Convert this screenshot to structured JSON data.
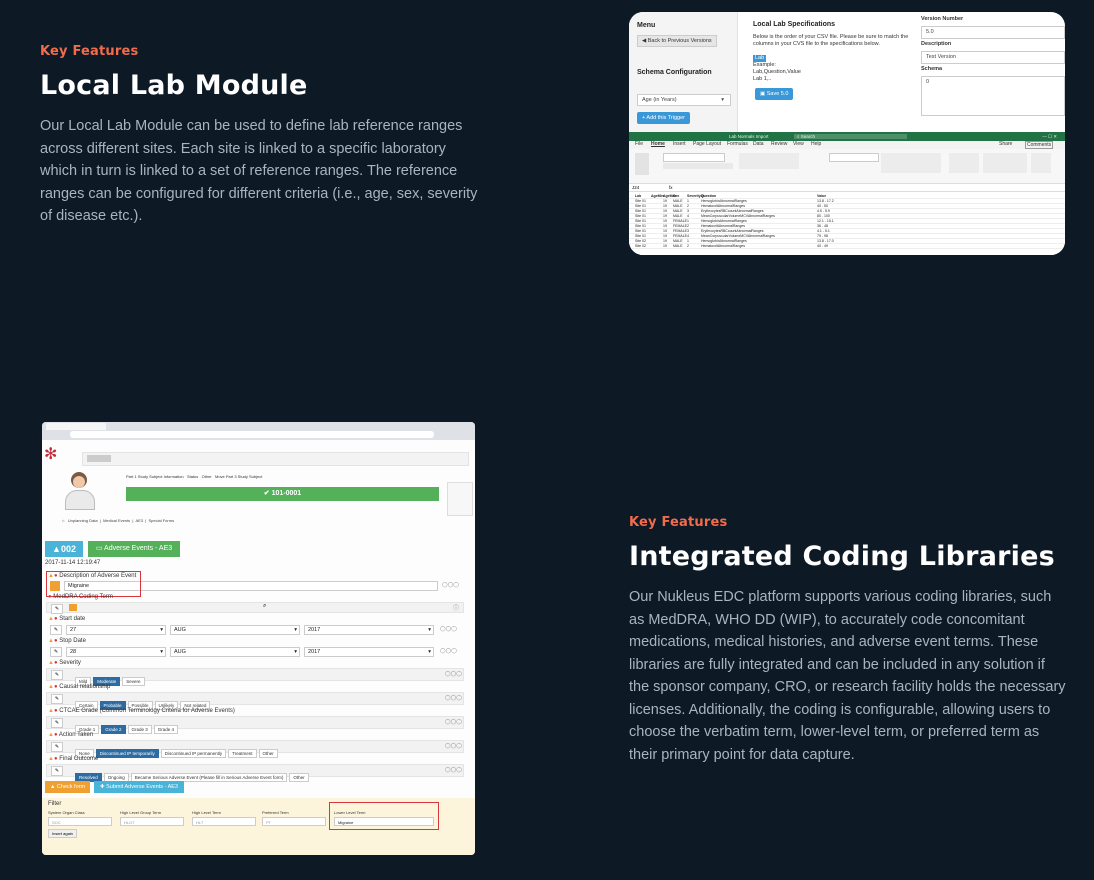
{
  "section1": {
    "eyebrow": "Key Features",
    "title": "Local Lab Module",
    "body": "Our Local Lab Module can be used to define lab reference ranges across different sites. Each site is linked to a specific laboratory which in turn is linked to a set of reference ranges. The reference ranges can be configured for different criteria (i.e., age, sex, severity of disease etc.)."
  },
  "section2": {
    "eyebrow": "Key Features",
    "title": "Integrated Coding Libraries",
    "body": "Our Nukleus EDC platform supports various coding libraries, such as MedDRA, WHO DD (WIP), to accurately code concomitant medications, medical histories, and adverse event terms. These libraries are fully integrated and can be included in any solution if the sponsor company, CRO, or research facility holds the necessary licenses. Additionally, the coding is configurable, allowing users to choose the verbatim term, lower-level term, or preferred term as their primary point for data capture."
  },
  "lab_shot": {
    "menu_title": "Menu",
    "back_button": "Back to Previous Versions",
    "schema_title": "Schema Configuration",
    "age_select": "Age (in Years)",
    "add_trigger": "+ Add this Trigger",
    "spec_title": "Local Lab Specifications",
    "spec_desc": "Below is the order of your CSV file. Please be sure to match the columns in your CVS file to the specifications below.",
    "lab_badge": "Lab",
    "example_label": "Example:",
    "example_cols": "Lab,Question,Value",
    "example_row": "Lab 1,..",
    "save_button": "Save 5.0",
    "version_label": "Version Number",
    "version_value": "5.0",
    "description_label": "Description",
    "description_value": "Test Version",
    "schema_label": "Schema",
    "schema_value": "0",
    "excel_title": "Lab Normals Import",
    "excel_search": "Search",
    "excel_tabs": [
      "File",
      "Home",
      "Insert",
      "Page Layout",
      "Formulas",
      "Data",
      "Review",
      "View",
      "Help"
    ],
    "excel_share": "Share",
    "excel_comments": "Comments",
    "excel_cell_ref": "J24",
    "excel_header": [
      "Lab",
      "AgeMin",
      "AgeMax",
      "Sex",
      "SeverityID",
      "Question",
      "Value"
    ],
    "excel_rows": [
      [
        "Site 01",
        "",
        "19",
        "MALE",
        "1",
        "HemoglobinAbnormalRanges",
        "13.8 - 17.2"
      ],
      [
        "Site 01",
        "",
        "19",
        "MALE",
        "2",
        "HematocritAbnormalRanges",
        "40 - 50"
      ],
      [
        "Site 01",
        "",
        "19",
        "MALE",
        "3",
        "ErythrocytesRBCcountAbnormalRanges",
        "4.5 - 5.9"
      ],
      [
        "Site 01",
        "",
        "19",
        "MALE",
        "4",
        "MeanCorpuscularVolumeMCVAbnormalRanges",
        "80 - 100"
      ],
      [
        "Site 01",
        "",
        "19",
        "FEMALE",
        "1",
        "HemoglobinAbnormalRanges",
        "12.1 - 15.1"
      ],
      [
        "Site 01",
        "",
        "19",
        "FEMALE",
        "2",
        "HematocritAbnormalRanges",
        "36 - 48"
      ],
      [
        "Site 01",
        "",
        "19",
        "FEMALE",
        "3",
        "ErythrocytesRBCcountAbnormalRanges",
        "4.1 - 5.1"
      ],
      [
        "Site 01",
        "",
        "19",
        "FEMALE",
        "4",
        "MeanCorpuscularVolumeMCVAbnormalRanges",
        "79 - 98"
      ],
      [
        "Site 02",
        "",
        "19",
        "MALE",
        "1",
        "HemoglobinAbnormalRanges",
        "13.8 - 17.0"
      ],
      [
        "Site 02",
        "",
        "19",
        "MALE",
        "2",
        "HematocritAbnormalRanges",
        "40 - 49"
      ]
    ]
  },
  "coding_shot": {
    "subject_id": "101-0001",
    "subject_tabs": [
      "Part 1 Study Subject Information",
      "Status",
      "Other",
      "Move Part 3 Study Subject"
    ],
    "breadcrumbs": [
      "Unplanning Data",
      "Medical Events",
      "AE3",
      "Special Forms"
    ],
    "counter_badge": "002",
    "ae_badge": "Adverse Events - AE3",
    "timestamp": "2017-11-14 12:19:47",
    "description_label": "Description of Adverse Event",
    "description_value": "Migraine",
    "meddra_label": "MedDRA Coding Term",
    "start_label": "Start date",
    "start_day": "27",
    "start_month": "AUG",
    "start_year": "2017",
    "stop_label": "Stop Date",
    "stop_day": "28",
    "stop_month": "AUG",
    "stop_year": "2017",
    "severity_label": "Severity",
    "severity_options": [
      "Mild",
      "Moderate",
      "Severe"
    ],
    "causal_label": "Causal relationship",
    "causal_options": [
      "Certain",
      "Probable",
      "Possible",
      "Unlikely",
      "Not related"
    ],
    "ctcae_label": "CTCAE Grade (Common Terminology Criteria for Adverse Events)",
    "ctcae_options": [
      "Grade 1",
      "Grade 2",
      "Grade 3",
      "Grade 4"
    ],
    "action_label": "Action Taken",
    "action_options": [
      "None",
      "Discontinued IP temporarily",
      "Discontinued IP permanently",
      "Treatment",
      "Other"
    ],
    "outcome_label": "Final Outcome",
    "outcome_options": [
      "Resolved",
      "Ongoing",
      "Became Serious Adverse Event (Please fill in Serious Adverse Event form)",
      "Other"
    ],
    "check_button": "Check form",
    "submit_button": "Submit Adverse Events - AE3",
    "filter_title": "Filter",
    "filter_fields": [
      "System Organ Class",
      "High Level Group Term",
      "High Level Term",
      "Preferred Term",
      "Lower Level Term"
    ],
    "filter_placeholders": [
      "SOC",
      "HLGT",
      "HLT",
      "PT",
      ""
    ],
    "filter_llt_value": "Migraine",
    "insert_button": "Insert again"
  }
}
